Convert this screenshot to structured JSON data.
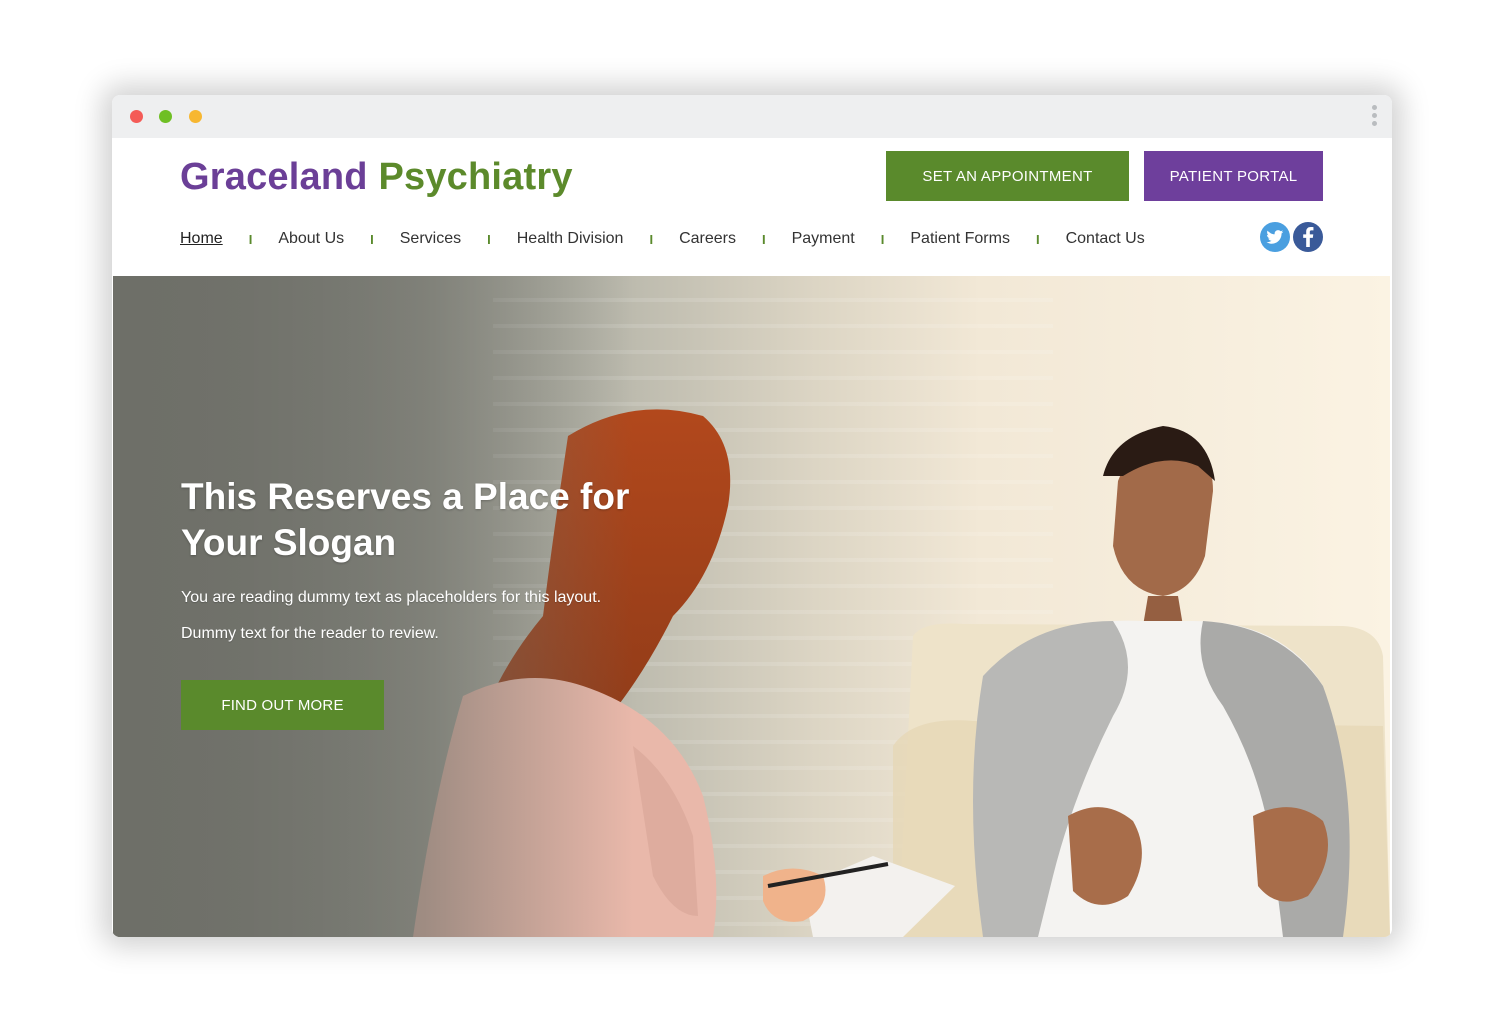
{
  "window": {
    "controls": [
      "close",
      "minimize",
      "maximize"
    ],
    "menu_icon": "kebab-menu-icon"
  },
  "header": {
    "logo": {
      "word1": "Graceland",
      "word2": "Psychiatry"
    },
    "appointment_label": "SET AN APPOINTMENT",
    "portal_label": "PATIENT PORTAL",
    "nav": [
      {
        "label": "Home",
        "active": true
      },
      {
        "label": "About Us"
      },
      {
        "label": "Services"
      },
      {
        "label": "Health Division"
      },
      {
        "label": "Careers"
      },
      {
        "label": "Payment"
      },
      {
        "label": "Patient Forms"
      },
      {
        "label": "Contact Us"
      }
    ],
    "nav_separator": "I",
    "social": [
      {
        "icon": "twitter-icon",
        "color": "#4a9fe0"
      },
      {
        "icon": "facebook-icon",
        "color": "#3a5a99"
      }
    ]
  },
  "hero": {
    "title": "This Reserves a Place for Your Slogan",
    "line1": "You are reading dummy text as placeholders for this layout.",
    "line2": "Dummy text for the reader to review.",
    "cta_label": "FIND OUT MORE"
  },
  "colors": {
    "purple": "#6e3f9c",
    "green": "#5a8a2c"
  }
}
